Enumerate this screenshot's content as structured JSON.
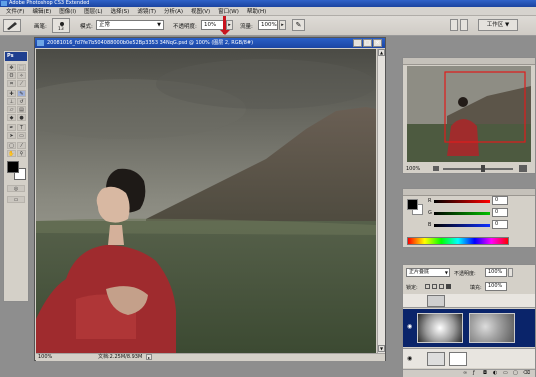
{
  "app": {
    "title": "Adobe Photoshop CS3 Extended"
  },
  "menu": [
    "文件(F)",
    "编辑(E)",
    "图像(I)",
    "图层(L)",
    "选择(S)",
    "滤镜(T)",
    "分析(A)",
    "视图(V)",
    "窗口(W)",
    "帮助(H)"
  ],
  "options": {
    "brush_label": "画笔:",
    "brush_size": "13",
    "mode_label": "模式:",
    "mode_value": "正常",
    "opacity_label": "不透明度:",
    "opacity_value": "10%",
    "flow_label": "流量:",
    "flow_value": "100%",
    "workspace_label": "工作区 ▼"
  },
  "toolbox": {
    "title": "Ps"
  },
  "document": {
    "title": "20081016_fd7fe7b504088000b0e52Bp3353 34NqG.psd @ 100% (图层 2, RGB/8#)",
    "zoom": "100%",
    "doc_size": "文档:2.25M/8.93M"
  },
  "navigator": {
    "zoom": "100%"
  },
  "color": {
    "r_label": "R",
    "g_label": "G",
    "b_label": "B",
    "r_value": "0",
    "g_value": "0",
    "b_value": "0"
  },
  "layers": {
    "blend_mode": "正片叠底",
    "opacity_label": "不透明度:",
    "opacity_value": "100%",
    "lock_label": "锁定:",
    "fill_label": "填充:",
    "fill_value": "100%"
  },
  "colors": {
    "titlebar": "#1a44a0",
    "panel_bg": "#d4d0c8",
    "workspace_bg": "#8e8e8e",
    "selected_layer": "#0a246a"
  }
}
